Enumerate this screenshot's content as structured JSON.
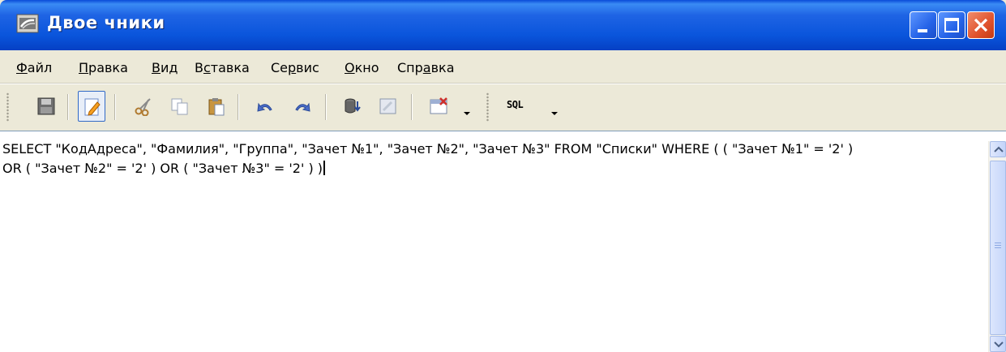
{
  "window": {
    "title": "Двое чники"
  },
  "menu": [
    {
      "label_pre": "",
      "label_u": "Ф",
      "label_post": "айл"
    },
    {
      "label_pre": "",
      "label_u": "П",
      "label_post": "равка"
    },
    {
      "label_pre": "",
      "label_u": "В",
      "label_post": "ид"
    },
    {
      "label_pre": "В",
      "label_u": "с",
      "label_post": "тавка"
    },
    {
      "label_pre": "Се",
      "label_u": "р",
      "label_post": "вис"
    },
    {
      "label_pre": "",
      "label_u": "О",
      "label_post": "кно"
    },
    {
      "label_pre": "Спр",
      "label_u": "а",
      "label_post": "вка"
    }
  ],
  "toolbar": {
    "sql_label": "SQL"
  },
  "editor": {
    "line1": "SELECT \"КодАдреса\", \"Фамилия\", \"Группа\", \"Зачет №1\", \"Зачет №2\", \"Зачет №3\" FROM \"Списки\" WHERE ( ( \"Зачет №1\" = '2' )",
    "line2": "OR ( \"Зачет №2\" = '2' ) OR ( \"Зачет №3\" = '2' ) )"
  },
  "colors": {
    "titlebar": "#0A55DC",
    "close": "#E0522C",
    "chrome": "#ECE9D8"
  }
}
